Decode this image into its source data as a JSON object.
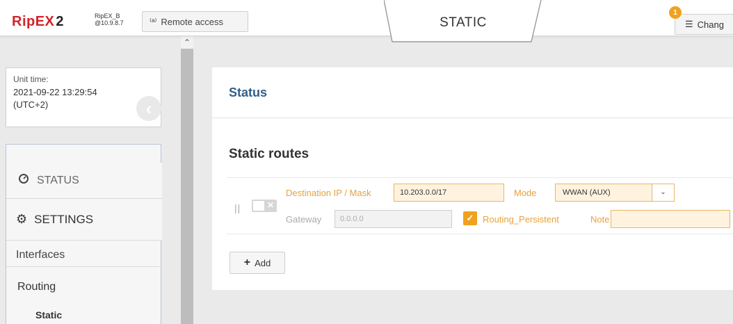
{
  "header": {
    "logo_main": "RipEX",
    "logo_suffix": "2",
    "device_name": "RipEX_B",
    "device_ip": "@10.9.8.7",
    "remote_access_label": "Remote access",
    "mode_tab": "STATIC",
    "changes_label": "Chang",
    "changes_count": "1"
  },
  "sidebar": {
    "unit_time_label": "Unit time:",
    "unit_time_value": "2021-09-22 13:29:54",
    "unit_time_zone": "(UTC+2)",
    "menu": {
      "status": "STATUS",
      "settings": "SETTINGS",
      "interfaces": "Interfaces",
      "routing": "Routing",
      "static": "Static"
    }
  },
  "main": {
    "status_title": "Status",
    "static_routes_title": "Static routes",
    "route": {
      "dest_label": "Destination IP / Mask",
      "dest_value": "10.203.0.0/17",
      "mode_label": "Mode",
      "mode_value": "WWAN (AUX)",
      "gateway_label": "Gateway",
      "gateway_placeholder": "0.0.0.0",
      "routing_persistent_label": "Routing_Persistent",
      "routing_persistent_checked": true,
      "note_label": "Note",
      "note_value": "",
      "enabled": false
    },
    "add_label": "Add"
  },
  "colors": {
    "brand_red": "#d3232a",
    "accent_orange": "#f0a21d",
    "title_blue": "#2f5f8a"
  }
}
